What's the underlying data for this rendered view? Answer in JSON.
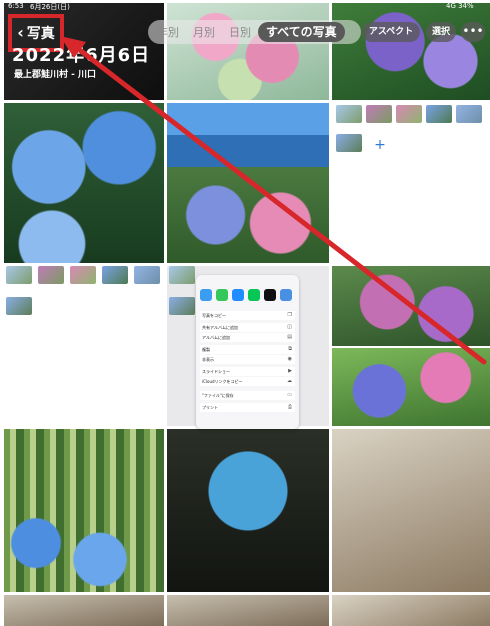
{
  "status": {
    "time": "6:53",
    "date": "6月26日(日)",
    "right": "4G 34%"
  },
  "header": {
    "back_label": "写真",
    "date_title": "2022年6月6日",
    "location": "最上郡鮭川村 - 川口"
  },
  "view_tabs": [
    {
      "label": "年別",
      "active": false
    },
    {
      "label": "月別",
      "active": false
    },
    {
      "label": "日別",
      "active": false
    },
    {
      "label": "すべての写真",
      "active": true
    }
  ],
  "actions": {
    "aspect_label": "アスペクト",
    "select_label": "選択",
    "more_label": "•••"
  },
  "share_sheet": {
    "items": [
      {
        "label": "写真をコピー",
        "icon": "copy-icon"
      },
      {
        "label": "共有アルバムに追加",
        "icon": "shared-album-icon"
      },
      {
        "label": "アルバムに追加",
        "icon": "album-icon"
      },
      {
        "label": "複製",
        "icon": "duplicate-icon"
      },
      {
        "label": "非表示",
        "icon": "hide-icon"
      },
      {
        "label": "スライドショー",
        "icon": "slideshow-icon"
      },
      {
        "label": "iCloudリンクをコピー",
        "icon": "cloud-link-icon"
      },
      {
        "label": "\"ファイル\"に保存",
        "icon": "files-icon"
      },
      {
        "label": "プリント",
        "icon": "print-icon"
      }
    ]
  },
  "add_label": "+",
  "colors": {
    "highlight": "#d8272a",
    "accent": "#2f79d6"
  }
}
